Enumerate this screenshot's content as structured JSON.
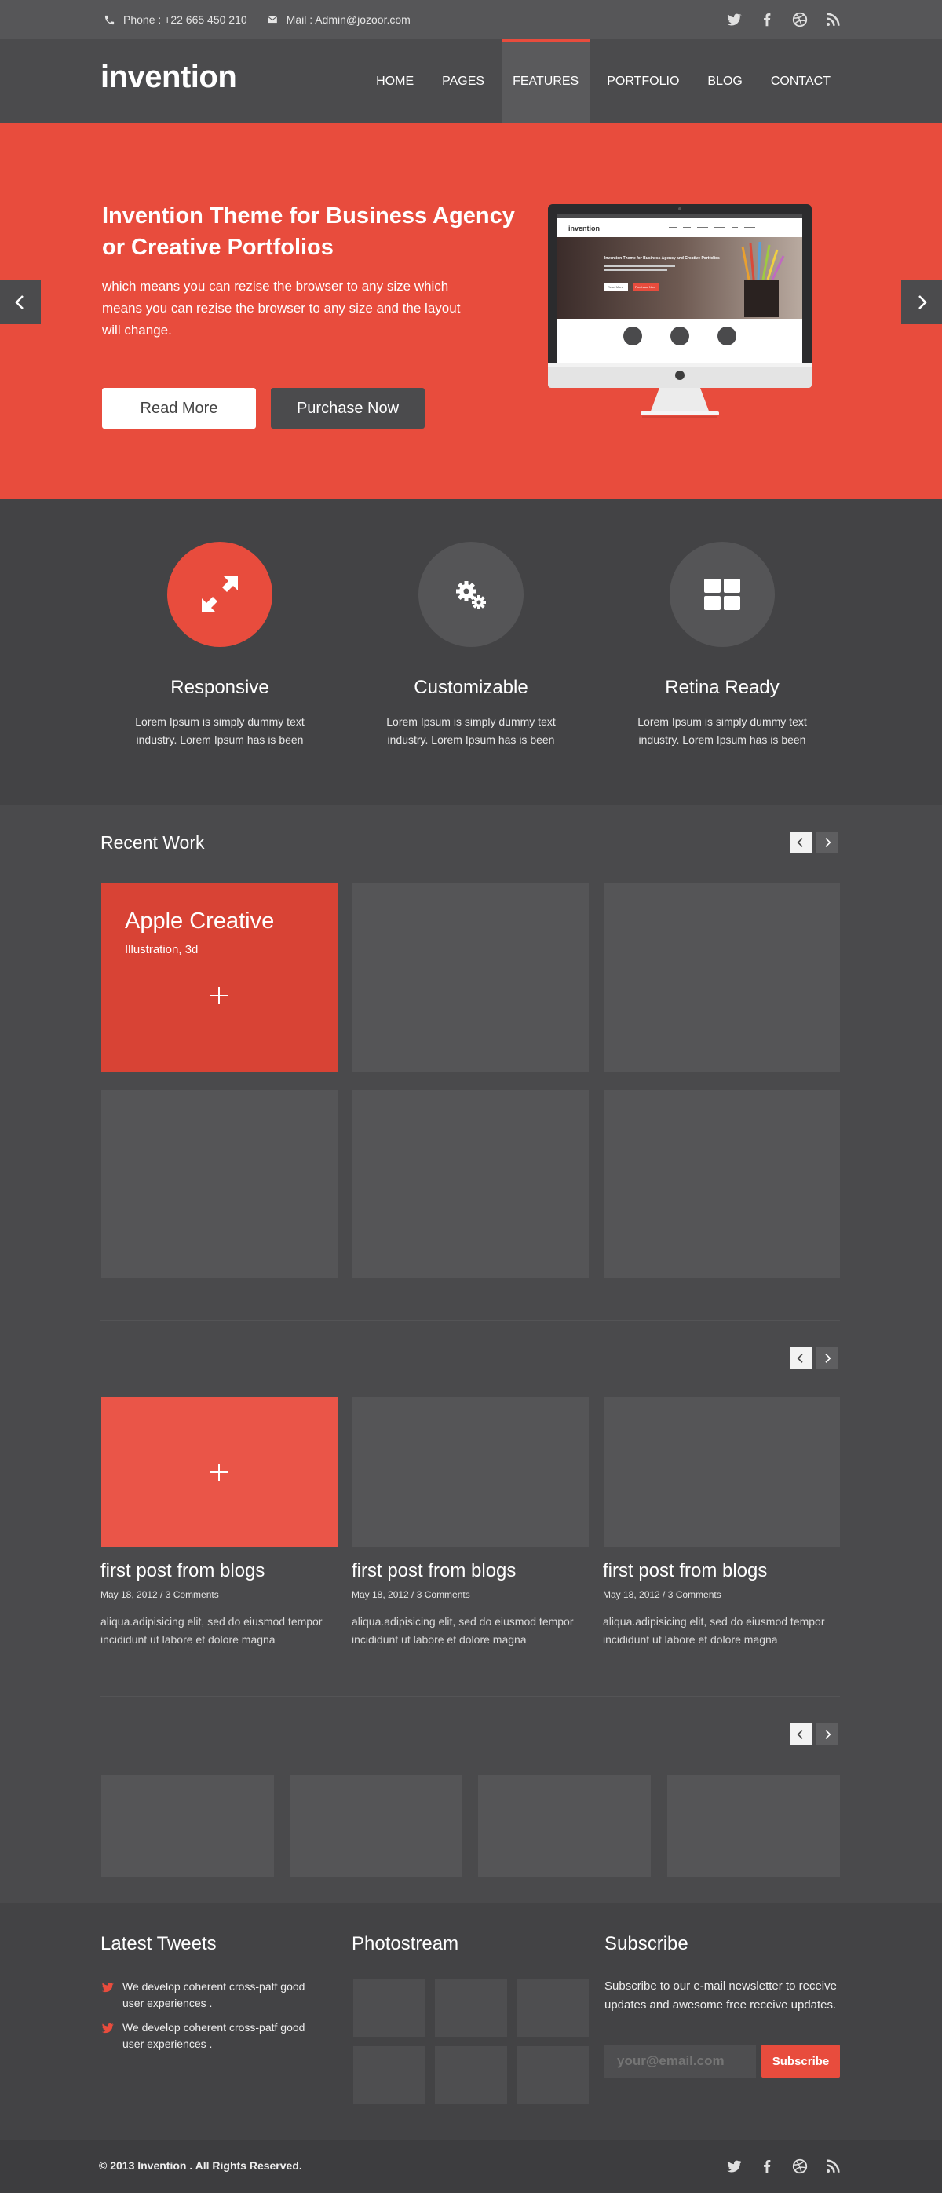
{
  "topbar": {
    "phone": "Phone : +22 665 450 210",
    "mail": "Mail : Admin@jozoor.com",
    "social": [
      "twitter-icon",
      "facebook-icon",
      "dribbble-icon",
      "rss-icon"
    ]
  },
  "header": {
    "logo": "invention",
    "nav": [
      {
        "label": "HOME",
        "active": false
      },
      {
        "label": "PAGES",
        "active": false
      },
      {
        "label": "FEATURES",
        "active": true
      },
      {
        "label": "PORTFOLIO",
        "active": false
      },
      {
        "label": "BLOG",
        "active": false
      },
      {
        "label": "CONTACT",
        "active": false
      }
    ]
  },
  "hero": {
    "title": "Invention Theme for Business Agency or Creative Portfolios",
    "text": "which means you can rezise the browser to any size which means you can rezise the browser to any size and the layout will change.",
    "read_more": "Read More",
    "purchase": "Purchase Now",
    "monitor": {
      "logo": "invention",
      "title": "Invention Theme for Business Agency and Creative Portfolios",
      "btn1": "Read More",
      "btn2": "Purchase Now"
    }
  },
  "features": [
    {
      "title": "Responsive",
      "text": "Lorem Ipsum is simply dummy text industry. Lorem Ipsum has is been",
      "icon": "expand-arrows-icon"
    },
    {
      "title": "Customizable",
      "text": "Lorem Ipsum is simply dummy text industry. Lorem Ipsum has is been",
      "icon": "gears-icon"
    },
    {
      "title": "Retina Ready",
      "text": "Lorem Ipsum is simply dummy text industry. Lorem Ipsum has is been",
      "icon": "grid-icon"
    }
  ],
  "recent_work": {
    "title": "Recent Work",
    "featured_title": "Apple Creative",
    "featured_sub": "Illustration, 3d"
  },
  "posts": [
    {
      "title": "first post from blogs",
      "meta": "May 18, 2012 / 3 Comments",
      "excerpt": "aliqua.adipisicing elit, sed do eiusmod tempor incididunt ut labore et dolore magna"
    },
    {
      "title": "first post from blogs",
      "meta": "May 18, 2012 / 3 Comments",
      "excerpt": "aliqua.adipisicing elit, sed do eiusmod tempor incididunt ut labore et dolore magna"
    },
    {
      "title": "first post from blogs",
      "meta": "May 18, 2012 / 3 Comments",
      "excerpt": "aliqua.adipisicing elit, sed do eiusmod tempor incididunt ut labore et dolore magna"
    }
  ],
  "footer": {
    "tweets_title": "Latest Tweets",
    "tweets": [
      "We develop coherent cross-patf good user experiences .",
      "We develop coherent cross-patf good user experiences ."
    ],
    "photostream_title": "Photostream",
    "subscribe_title": "Subscribe",
    "subscribe_text": "Subscribe to our e-mail newsletter to receive updates and awesome free receive updates.",
    "email_placeholder": "your@email.com",
    "subscribe_button": "Subscribe",
    "copyright": "© 2013 Invention . All Rights Reserved."
  },
  "colors": {
    "accent": "#e84c3d",
    "dark": "#4a4a4c"
  }
}
